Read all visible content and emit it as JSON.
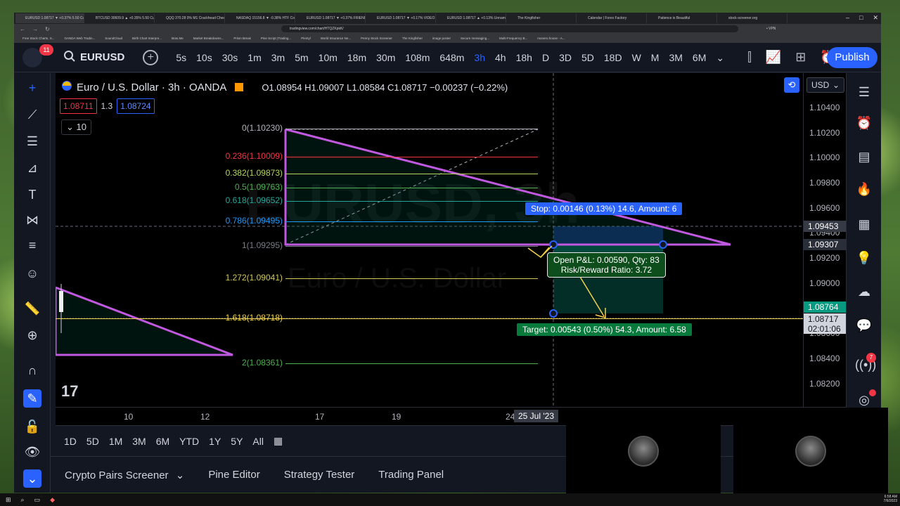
{
  "browser": {
    "tabs": [
      "EURUSD 1.08717 ▼ +0.37% 5.50 Cu...",
      "BTCUSD 30609.9 ▲ +0.35% 5.50 Cu...",
      "QQQ 370.28 0% M1 Crackhead Chess",
      "NASDAQ 15156.8 ▼ -0.38% HTF Cou...",
      "EURUSD 1.08717 ▼ +0.37% FRIENDS",
      "EURUSD 1.08717 ▼ +0.17% VIDEO PL...",
      "EURUSD 1.08717 ▲ +0.13% Unnamed",
      "The Kingfisher",
      "Calendar | Forex Factory",
      "Patience is Beautiful",
      "stock-screener.org"
    ],
    "url": "tradingview.com/chart/HTQZKpkK/",
    "bookmarks": [
      "Free Stock Charts, S...",
      "OANDA Web Tradin...",
      "SoundCloud",
      "Birth Chart Interpre...",
      "Bras.Me",
      "Market Breakdowns...",
      "Prism Break",
      "Pine Script (Trading...",
      "Plentyl",
      "World Insurance Ne...",
      "Penny Stock Screener",
      "The Kingfisher",
      "image poster",
      "Secure messaging...",
      "Multi-Frequency B...",
      "monero.house - A..."
    ],
    "vpn": "• VPN"
  },
  "topbar": {
    "notification_count": "11",
    "symbol": "EURUSD",
    "intervals": [
      "5s",
      "10s",
      "30s",
      "1m",
      "3m",
      "5m",
      "10m",
      "18m",
      "30m",
      "108m",
      "648m",
      "3h",
      "4h",
      "18h",
      "D",
      "3D",
      "5D",
      "18D",
      "W",
      "M",
      "3M",
      "6M"
    ],
    "active_interval": "3h",
    "publish_label": "Publish"
  },
  "legend": {
    "title": "Euro / U.S. Dollar · 3h · OANDA",
    "ohlc": "O1.08954 H1.09007 L1.08584 C1.08717 −0.00237 (−0.22%)",
    "bid": "1.08711",
    "spread": "1.3",
    "ask": "1.08724",
    "indicator_count": "10"
  },
  "watermark": {
    "symbol": "EURUSD, 3h",
    "name": "Euro / U.S. Dollar"
  },
  "fib_levels": [
    {
      "label": "0(1.10230)",
      "color": "#b2b5be"
    },
    {
      "label": "0.236(1.10009)",
      "color": "#f23645"
    },
    {
      "label": "0.382(1.09873)",
      "color": "#b6d860"
    },
    {
      "label": "0.5(1.09763)",
      "color": "#4caf50"
    },
    {
      "label": "0.618(1.09652)",
      "color": "#26a69a"
    },
    {
      "label": "0.786(1.09495)",
      "color": "#2196f3"
    },
    {
      "label": "1(1.09295)",
      "color": "#787b86"
    },
    {
      "label": "1.272(1.09041)",
      "color": "#d4c85a"
    },
    {
      "label": "1.618(1.08718)",
      "color": "#f3d24b"
    },
    {
      "label": "2(1.08361)",
      "color": "#4caf50"
    }
  ],
  "position": {
    "stop_label": "Stop: 0.00146 (0.13%) 14.6, Amount: 6",
    "pnl_line1": "Open P&L: 0.00590, Qty: 83",
    "pnl_line2": "Risk/Reward Ratio: 3.72",
    "target_label": "Target: 0.00543 (0.50%) 54.3, Amount: 6.58"
  },
  "price_axis": {
    "currency": "USD",
    "labels": [
      "1.10400",
      "1.10200",
      "1.10000",
      "1.09800",
      "1.09600",
      "1.09400",
      "1.09200",
      "1.09000",
      "1.08800",
      "1.08600",
      "1.08400",
      "1.08200"
    ],
    "crosshair_price": "1.09453",
    "entry_price": "1.09307",
    "target_price": "1.08764",
    "last_price": "1.08717",
    "countdown": "02:01:06"
  },
  "time_axis": {
    "labels": [
      "10",
      "12",
      "17",
      "19",
      "24"
    ],
    "crosshair_date": "25 Jul '23"
  },
  "ranges": [
    "1D",
    "5D",
    "1M",
    "3M",
    "6M",
    "YTD",
    "1Y",
    "5Y",
    "All"
  ],
  "bottom_tabs": [
    "Crypto Pairs Screener",
    "Pine Editor",
    "Strategy Tester",
    "Trading Panel"
  ],
  "right_badge": "7",
  "taskbar": {
    "time": "6:58 AM",
    "date": "7/6/2023"
  },
  "colors": {
    "accent": "#2962ff",
    "drawing": "#c058e0",
    "up": "#089981",
    "down": "#f23645"
  }
}
